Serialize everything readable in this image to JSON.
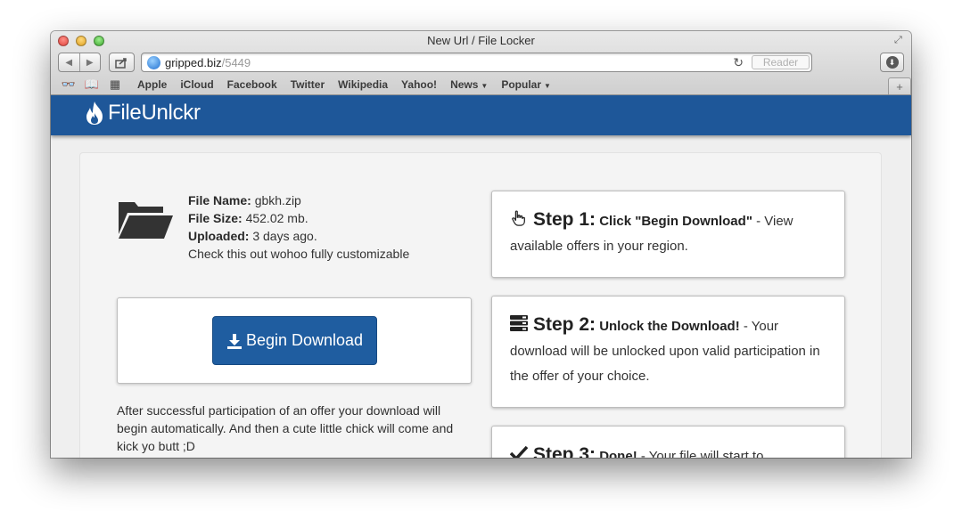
{
  "browser": {
    "window_title": "New Url / File Locker",
    "url_host": "gripped.biz",
    "url_path": "/5449",
    "reader_label": "Reader",
    "bookmarks": [
      "Apple",
      "iCloud",
      "Facebook",
      "Twitter",
      "Wikipedia",
      "Yahoo!"
    ],
    "bookmark_menus": [
      "News",
      "Popular"
    ],
    "newtab_label": "+"
  },
  "site": {
    "logo_text": "FileUnlckr"
  },
  "file": {
    "name_label": "File Name:",
    "name_value": "gbkh.zip",
    "size_label": "File Size:",
    "size_value": "452.02 mb.",
    "uploaded_label": "Uploaded:",
    "uploaded_value": "3 days ago.",
    "description": "Check this out wohoo fully customizable"
  },
  "download": {
    "button_label": "Begin Download",
    "after_text": "After successful participation of an offer your download will begin automatically. And then a cute little chick will come and kick yo butt ;D"
  },
  "steps": [
    {
      "title": "Step 1:",
      "action": "Click \"Begin Download\"",
      "text": " - View available offers in your region.",
      "icon": "hand-pointer-icon"
    },
    {
      "title": "Step 2:",
      "action": "Unlock the Download!",
      "text": " - Your download will be unlocked upon valid participation in the offer of your choice.",
      "icon": "tasks-icon"
    },
    {
      "title": "Step 3:",
      "action": "Done!",
      "text": " - Your file will start to",
      "icon": "check-icon"
    }
  ],
  "colors": {
    "header_blue": "#1e5799",
    "button_blue": "#1f5da0"
  }
}
